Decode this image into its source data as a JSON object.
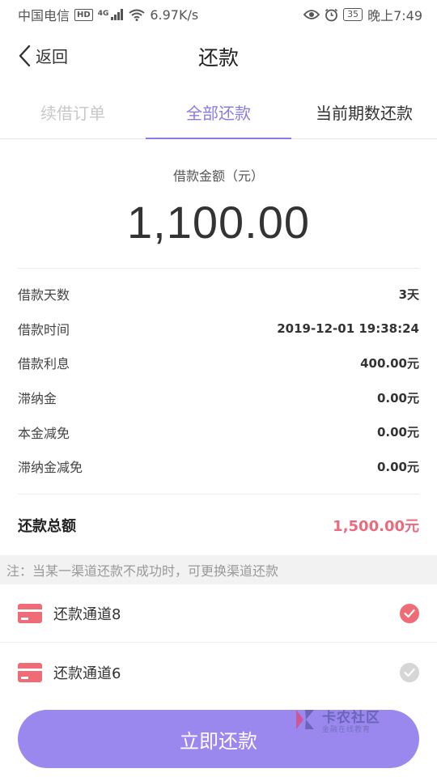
{
  "status_bar": {
    "carrier": "中国电信",
    "hd": "HD",
    "network": "4G",
    "speed": "6.97K/s",
    "battery": "35",
    "time": "晚上7:49"
  },
  "nav": {
    "back_label": "返回",
    "title": "还款"
  },
  "tabs": [
    {
      "label": "续借订单"
    },
    {
      "label": "全部还款"
    },
    {
      "label": "当前期数还款"
    }
  ],
  "amount": {
    "label": "借款金额（元）",
    "value": "1,100.00"
  },
  "details": [
    {
      "key": "借款天数",
      "value": "3天"
    },
    {
      "key": "借款时间",
      "value": "2019-12-01 19:38:24"
    },
    {
      "key": "借款利息",
      "value": "400.00元"
    },
    {
      "key": "滞纳金",
      "value": "0.00元"
    },
    {
      "key": "本金减免",
      "value": "0.00元"
    },
    {
      "key": "滞纳金减免",
      "value": "0.00元"
    }
  ],
  "total": {
    "label": "还款总额",
    "value": "1,500.00元"
  },
  "notice": "注：当某一渠道还款不成功时，可更换渠道还款",
  "channels": [
    {
      "label": "还款通道8",
      "selected": true
    },
    {
      "label": "还款通道6",
      "selected": false
    }
  ],
  "submit_label": "立即还款",
  "watermark": {
    "title": "卡农社区",
    "subtitle": "金融在线教育"
  },
  "colors": {
    "accent": "#8a7ce8",
    "button": "#9a88ef",
    "highlight": "#e86b7e",
    "card": "#ef6b76"
  }
}
